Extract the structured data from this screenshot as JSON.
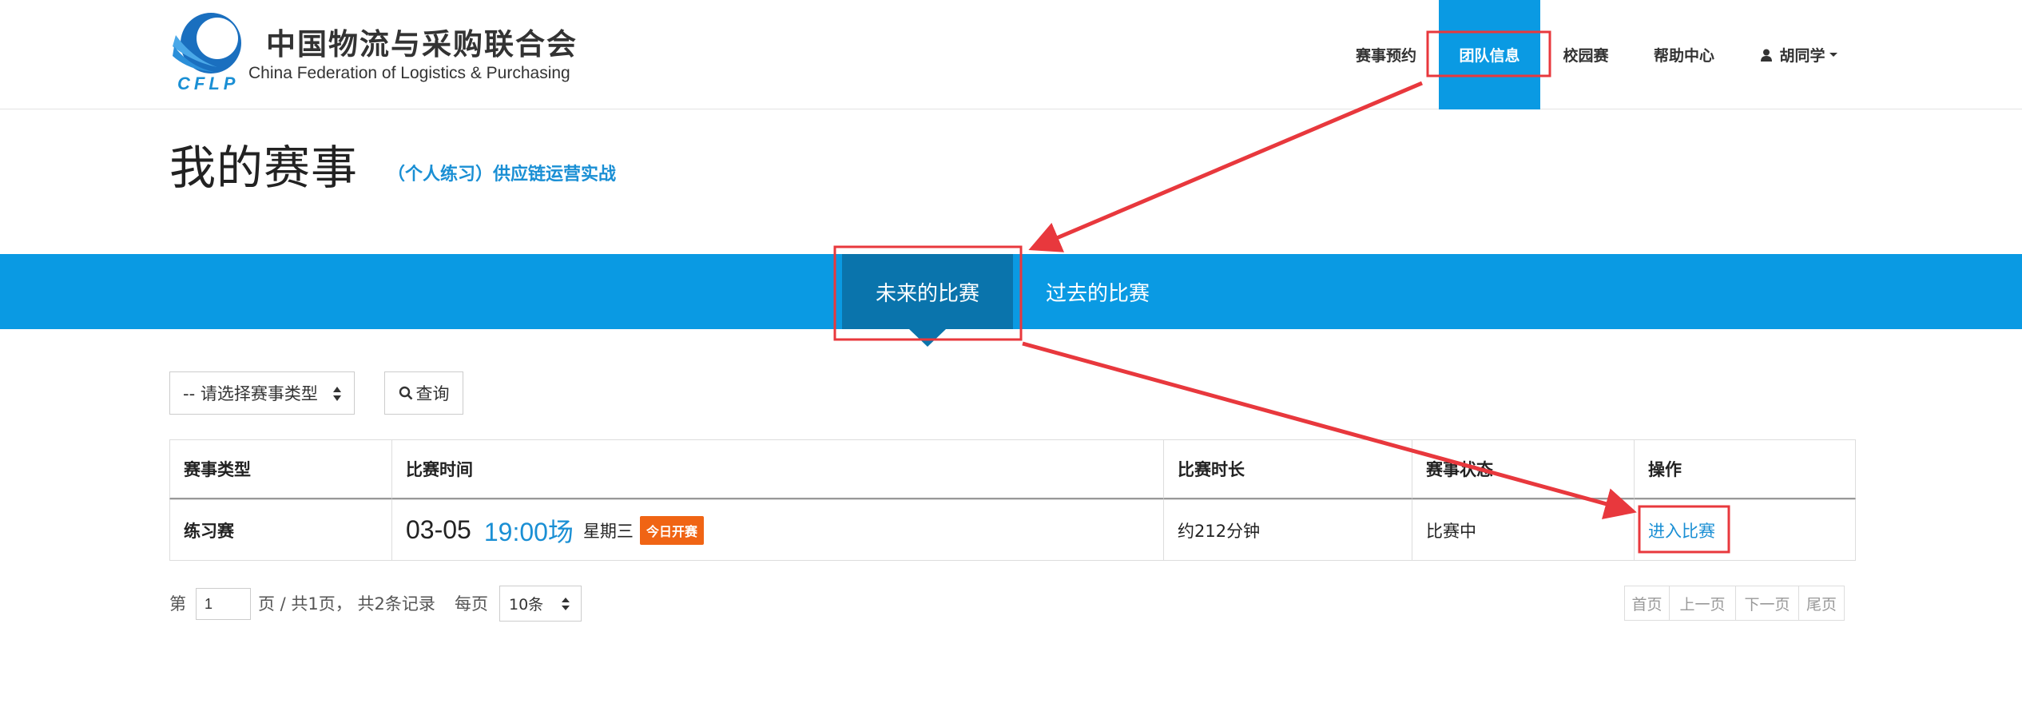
{
  "header": {
    "logo_cn": "中国物流与采购联合会",
    "logo_en": "China Federation of Logistics & Purchasing",
    "logo_abbr": "CFLP",
    "nav": [
      {
        "label": "赛事预约"
      },
      {
        "label": "团队信息",
        "active": true
      },
      {
        "label": "校园赛"
      },
      {
        "label": "帮助中心"
      }
    ],
    "user": "胡同学",
    "accent_color": "#0a9ae3"
  },
  "page": {
    "title": "我的赛事",
    "subtitle": "（个人练习）供应链运营实战"
  },
  "tabs": [
    {
      "label": "未来的比赛",
      "active": true
    },
    {
      "label": "过去的比赛"
    }
  ],
  "filter": {
    "select_label": "-- 请选择赛事类型",
    "query_label": "查询"
  },
  "table": {
    "headers": [
      "赛事类型",
      "比赛时间",
      "比赛时长",
      "赛事状态",
      "操作"
    ],
    "rows": [
      {
        "type": "练习赛",
        "date": "03-05",
        "time": "19:00场",
        "weekday": "星期三",
        "badge": "今日开赛",
        "duration": "约212分钟",
        "status": "比赛中",
        "action": "进入比赛"
      }
    ]
  },
  "pagination": {
    "prefix": "第",
    "page": "1",
    "suffix": "页 / 共1页， 共2条记录",
    "per_page_label": "每页",
    "per_page_value": "10条",
    "buttons": [
      "首页",
      "上一页",
      "下一页",
      "尾页"
    ]
  },
  "annotation_color": "#e8383d"
}
